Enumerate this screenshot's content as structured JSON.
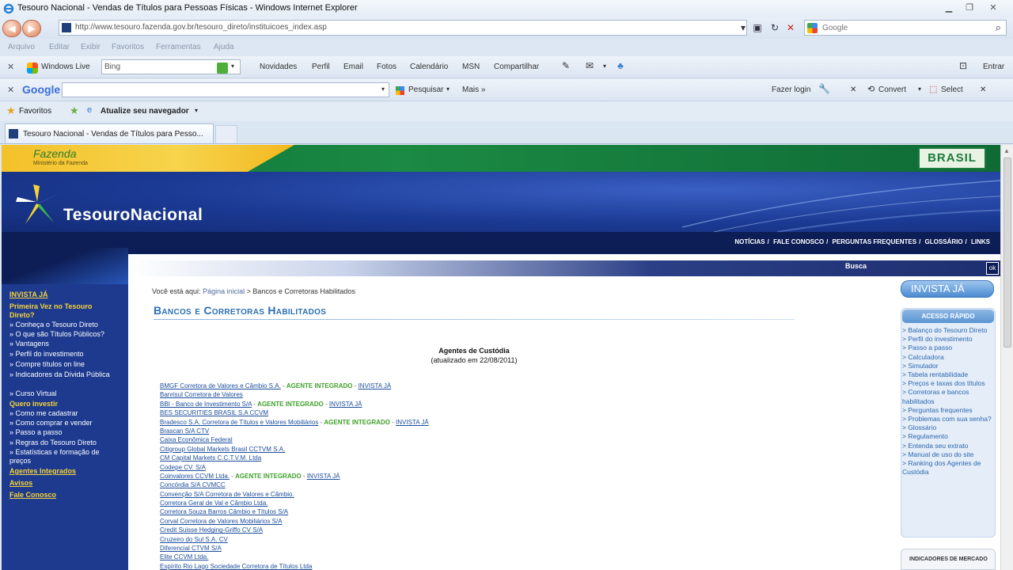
{
  "window": {
    "title": "Tesouro Nacional - Vendas de Títulos para Pessoas Físicas - Windows Internet Explorer",
    "address": "http://www.tesouro.fazenda.gov.br/tesouro_direto/instituicoes_index.asp",
    "search_engine": "Google"
  },
  "menu": [
    "Arquivo",
    "Editar",
    "Exibir",
    "Favoritos",
    "Ferramentas",
    "Ajuda"
  ],
  "live_toolbar": {
    "brand": "Windows Live",
    "search_value": "Bing",
    "links": [
      "Novidades",
      "Perfil",
      "Email",
      "Fotos",
      "Calendário",
      "MSN",
      "Compartilhar"
    ],
    "signin": "Entrar"
  },
  "google_toolbar": {
    "brand": "Google",
    "search_button": "Pesquisar",
    "more": "Mais »",
    "login": "Fazer login",
    "convert": "Convert",
    "select": "Select"
  },
  "favorites": {
    "label": "Favoritos",
    "update": "Atualize seu navegador"
  },
  "tab": {
    "label": "Tesouro Nacional - Vendas de Títulos para Pesso..."
  },
  "site": {
    "fazenda": "Fazenda",
    "fazenda_sub": "Ministério da Fazenda",
    "brasil": "BRASIL",
    "brand": "TesouroNacional",
    "topnav": [
      "NOTÍCIAS",
      "FALE CONOSCO",
      "PERGUNTAS FREQUENTES",
      "GLOSSÁRIO",
      "LINKS"
    ],
    "busca": "Busca",
    "ok": "ok"
  },
  "sidebar": {
    "items": [
      {
        "text": "INVISTA JÁ",
        "type": "head"
      },
      {
        "text": "Primeira Vez no Tesouro Direto?",
        "type": "head"
      },
      {
        "text": "» Conheça o Tesouro Direto",
        "type": "item"
      },
      {
        "text": "» O que são Títulos Públicos?",
        "type": "item"
      },
      {
        "text": "» Vantagens",
        "type": "item"
      },
      {
        "text": "» Perfil do investimento",
        "type": "item"
      },
      {
        "text": "» Compre títulos on line",
        "type": "item"
      },
      {
        "text": "» Indicadores da Dívida Pública",
        "type": "item"
      },
      {
        "text": "» Curso Virtual",
        "type": "item"
      },
      {
        "text": "Quero investir",
        "type": "head"
      },
      {
        "text": "» Como me cadastrar",
        "type": "item"
      },
      {
        "text": "» Como comprar e vender",
        "type": "item"
      },
      {
        "text": "» Passo a passo",
        "type": "item"
      },
      {
        "text": "» Regras do Tesouro Direto",
        "type": "item"
      },
      {
        "text": "» Estatísticas e formação de preços",
        "type": "item"
      },
      {
        "text": "Agentes Integrados",
        "type": "head"
      },
      {
        "text": "Avisos",
        "type": "head"
      },
      {
        "text": "Fale Conosco",
        "type": "head"
      }
    ]
  },
  "main": {
    "breadcrumb_prefix": "Você está aqui:",
    "breadcrumb_home": "Página inicial",
    "breadcrumb_current": "> Bancos e Corretoras Habilitados",
    "heading": "Bancos e Corretoras Habilitados",
    "agents_title": "Agentes de Custódia",
    "agents_updated": "(atualizado em 22/08/2011)",
    "integrated_label": "AGENTE INTEGRADO",
    "invista_label": "INVISTA JÁ",
    "agents": [
      {
        "name": "BMGF Corretora de Valores e Câmbio S.A.",
        "integrated": true
      },
      {
        "name": "Banrisul Corretora de Valores",
        "integrated": false
      },
      {
        "name": "BBI - Banco de Investimento S/A",
        "integrated": true
      },
      {
        "name": "BES SECURITIES BRASIL S.A CCVM",
        "integrated": false
      },
      {
        "name": "Bradesco S.A. Corretora de Títulos e Valores Mobiliários",
        "integrated": true
      },
      {
        "name": "Brascan S/A CTV",
        "integrated": false
      },
      {
        "name": "Caixa Econômica Federal",
        "integrated": false
      },
      {
        "name": "Citigroup Global Markets Brasil CCTVM S.A.",
        "integrated": false
      },
      {
        "name": "CM Capital Markets C.C.T.V.M. Ltda",
        "integrated": false
      },
      {
        "name": "Codepe CV. S/A",
        "integrated": false
      },
      {
        "name": "Coinvalores CCVM Ltda.",
        "integrated": true
      },
      {
        "name": "Concórdia S/A CVMCC",
        "integrated": false
      },
      {
        "name": "Convenção S/A Corretora de Valores e Câmbio.",
        "integrated": false
      },
      {
        "name": "Corretora Geral de Val e Câmbio Ltda.",
        "integrated": false
      },
      {
        "name": "Corretora Souza Barros Câmbio e Títulos S/A",
        "integrated": false
      },
      {
        "name": "Corval Corretora de Valores Mobiliários S/A",
        "integrated": false
      },
      {
        "name": "Credit Suisse Hedging-Griffo CV S/A",
        "integrated": false
      },
      {
        "name": "Cruzeiro do Sul S.A. CV",
        "integrated": false
      },
      {
        "name": "Diferencial CTVM S/A",
        "integrated": false
      },
      {
        "name": "Elite CCVM Ltda.",
        "integrated": false
      },
      {
        "name": "Espírito Rio Lago Sociedade Corretora de Títulos Ltda",
        "integrated": false
      }
    ]
  },
  "right": {
    "invista_button": "INVISTA JÁ",
    "acesso_title": "ACESSO RÁPIDO",
    "acesso_items": [
      "> Balanço do Tesouro Direto",
      "> Perfil do investimento",
      "> Passo a passo",
      "> Calculadora",
      "> Simulador",
      "> Tabela rentabilidade",
      "> Preços e taxas dos títulos",
      "> Corretoras e bancos habilitados",
      "> Perguntas frequentes",
      "> Problemas com sua senha?",
      "> Glossário",
      "> Regulamento",
      "> Entenda seu extrato",
      "> Manual de uso do site",
      "> Ranking dos Agentes de Custódia"
    ],
    "indicadores": "INDICADORES DE MERCADO"
  }
}
